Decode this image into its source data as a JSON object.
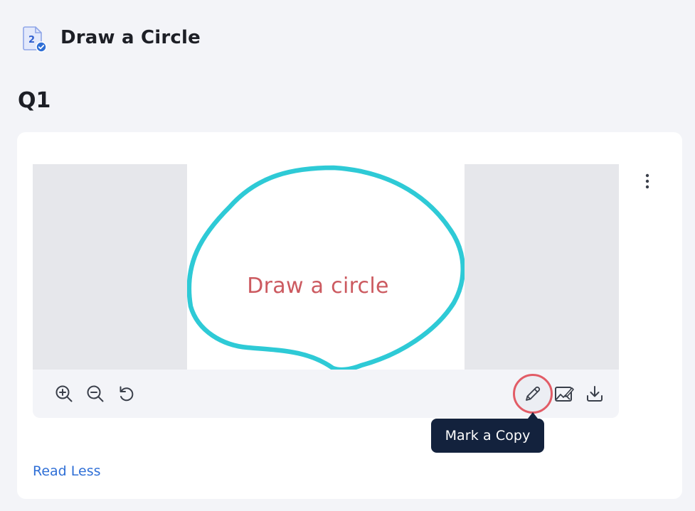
{
  "header": {
    "title": "Draw a Circle",
    "icon": "document-check-icon",
    "icon_badge_text": "2"
  },
  "question": {
    "label": "Q1"
  },
  "viewer": {
    "image_text": "Draw a circle",
    "stroke_color": "#2ecad6",
    "text_color": "#cc5a60"
  },
  "toolbar": {
    "zoom_in": "zoom-in-icon",
    "zoom_out": "zoom-out-icon",
    "rotate": "rotate-left-icon",
    "mark_copy": "pencil-icon",
    "annotate_image": "image-edit-icon",
    "download": "download-icon"
  },
  "tooltip": {
    "text": "Mark a Copy"
  },
  "card": {
    "more_icon": "more-vertical-icon",
    "read_less_label": "Read Less"
  },
  "colors": {
    "accent": "#2f6fd6",
    "tooltip_bg": "#13223d",
    "highlight": "#e25c66"
  }
}
